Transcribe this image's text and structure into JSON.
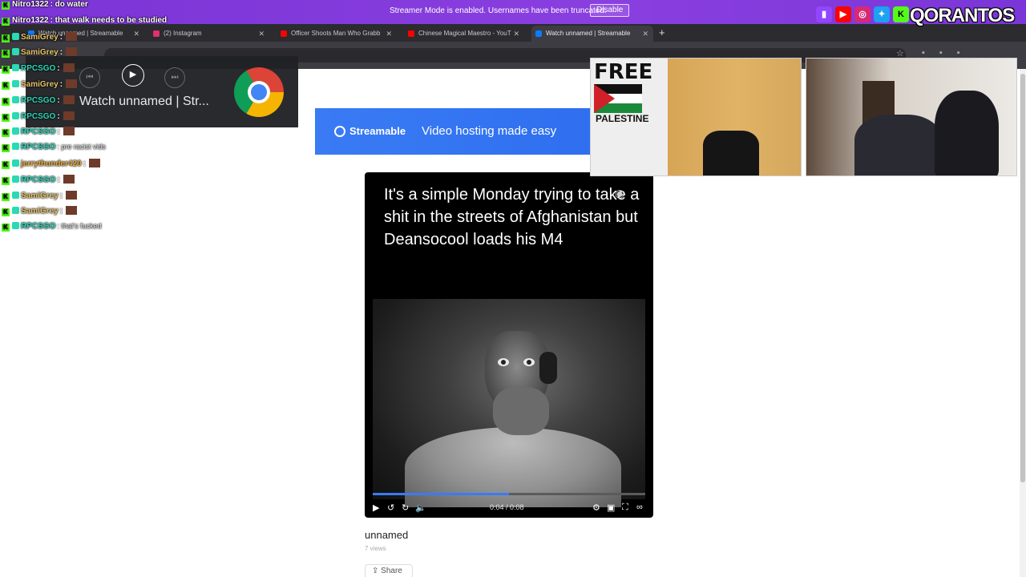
{
  "streamer_bar": {
    "message": "Streamer Mode is enabled. Usernames have been truncated.",
    "disable_label": "Disable"
  },
  "tabs": [
    {
      "label": "Watch unnamed | Streamable",
      "favicon_color": "#0b7cff",
      "active": false
    },
    {
      "label": "(2) Instagram",
      "favicon_color": "#e1306c",
      "active": false
    },
    {
      "label": "Officer Shoots Man Who Grabb",
      "favicon_color": "#ff0000",
      "active": false
    },
    {
      "label": "Chinese Magical Maestro - YouT",
      "favicon_color": "#ff0000",
      "active": false
    },
    {
      "label": "Watch unnamed | Streamable",
      "favicon_color": "#0b7cff",
      "active": true
    }
  ],
  "new_tab_label": "+",
  "media_card": {
    "title": "Watch unnamed | Str...",
    "prev_label": "⏮",
    "play_label": "▶",
    "next_label": "⏭"
  },
  "banner": {
    "brand": "Streamable",
    "tagline": "Video hosting made easy"
  },
  "video": {
    "caption": "It's a simple Monday trying to take a shit in the streets of Afghanistan but Deansocool loads his M4",
    "current_time": "0:04",
    "duration": "0:08",
    "time_display": "0:04 / 0:08",
    "progress_fraction": 0.5,
    "title": "unnamed",
    "views": "7 views",
    "share_label": "Share"
  },
  "chat": [
    {
      "user": "Nitro1322",
      "user_color": "#ffffff",
      "message": ": do water"
    },
    {
      "user": "Nitro1322",
      "user_color": "#ffffff",
      "message": ": that walk needs to be studied"
    },
    {
      "user": "SamiGrey",
      "user_color": "#e8c46a",
      "message": ":"
    },
    {
      "user": "SamiGrey",
      "user_color": "#e8c46a",
      "message": ":"
    },
    {
      "user": "RPCSGO",
      "user_color": "#2ad7b9",
      "message": ":"
    },
    {
      "user": "SamiGrey",
      "user_color": "#e8c46a",
      "message": ":"
    },
    {
      "user": "RPCSGO",
      "user_color": "#2ad7b9",
      "message": ":"
    },
    {
      "user": "RPCSGO",
      "user_color": "#2ad7b9",
      "message": ":"
    },
    {
      "user": "RPCSGO",
      "user_color": "#2ad7b9",
      "message": ":"
    },
    {
      "user": "RPCSGO",
      "user_color": "#2ad7b9",
      "message": ": pre racist vids"
    },
    {
      "user": "jerrythunder420",
      "user_color": "#e8a93a",
      "message": ":"
    },
    {
      "user": "RPCSGO",
      "user_color": "#2ad7b9",
      "message": ":"
    },
    {
      "user": "SamiGrey",
      "user_color": "#e8c46a",
      "message": ":"
    },
    {
      "user": "SamiGrey",
      "user_color": "#e8c46a",
      "message": ":"
    },
    {
      "user": "RPCSGO",
      "user_color": "#2ad7b9",
      "message": ": that's fucked"
    }
  ],
  "webcam": {
    "poster_top": "FREE",
    "poster_bottom": "PALESTINE"
  },
  "socials": {
    "brand": "QORANTOS",
    "icons": [
      "twitch-icon",
      "youtube-icon",
      "instagram-icon",
      "twitter-icon",
      "kick-icon"
    ]
  },
  "colors": {
    "streamer_bar": "#7b34d6",
    "streamable_blue": "#3a7bf4",
    "kick_green": "#53fc18"
  }
}
